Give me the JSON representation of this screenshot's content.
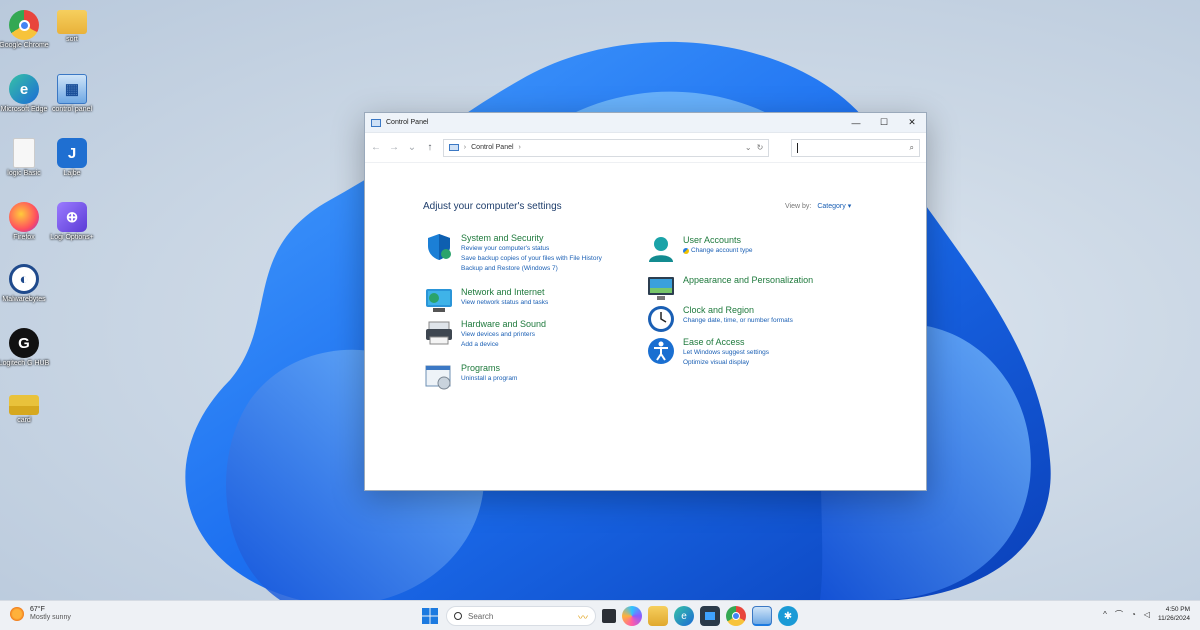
{
  "desktop": {
    "icons": [
      {
        "label": "Google Chrome",
        "color": "#e8453c",
        "glyph": "●"
      },
      {
        "label": "Microsoft Edge",
        "color": "#1c8ad6",
        "glyph": "e"
      },
      {
        "label": "logic Basic",
        "color": "#f2f2f2",
        "glyph": ""
      },
      {
        "label": "Firefox",
        "color": "#ff7139",
        "glyph": "●"
      },
      {
        "label": "Malwarebytes",
        "color": "#1f4a8c",
        "glyph": "◐"
      },
      {
        "label": "Logitech G HUB",
        "color": "#111111",
        "glyph": "G"
      },
      {
        "label": "card",
        "color": "#e9c23b",
        "glyph": "▬"
      },
      {
        "label": "sort",
        "color": "#f1c24c",
        "glyph": "▭"
      },
      {
        "label": "control panel",
        "color": "#4a8fd6",
        "glyph": "▦"
      },
      {
        "label": "Lajbe",
        "color": "#1f6fd1",
        "glyph": "J"
      },
      {
        "label": "Logi Options+",
        "color": "#7b5bd6",
        "glyph": "⊕"
      }
    ]
  },
  "window": {
    "title": "Control Panel",
    "controls": {
      "minimize": "—",
      "maximize": "☐",
      "close": "✕"
    },
    "nav": {
      "back": "←",
      "forward": "→",
      "recent": "⌄",
      "up": "↑"
    },
    "address": {
      "separator": "›",
      "location": "Control Panel",
      "dropdown": "⌄",
      "refresh": "↻"
    },
    "search": {
      "placeholder": "",
      "icon": "⌕"
    },
    "heading": "Adjust your computer's settings",
    "view_by": {
      "label": "View by:",
      "value": "Category ▾"
    },
    "categories_left": [
      {
        "title": "System and Security",
        "links": [
          "Review your computer's status",
          "Save backup copies of your files with File History",
          "Backup and Restore (Windows 7)"
        ],
        "icon": "shield-icon"
      },
      {
        "title": "Network and Internet",
        "links": [
          "View network status and tasks"
        ],
        "icon": "network-icon"
      },
      {
        "title": "Hardware and Sound",
        "links": [
          "View devices and printers",
          "Add a device"
        ],
        "icon": "printer-icon"
      },
      {
        "title": "Programs",
        "links": [
          "Uninstall a program"
        ],
        "icon": "programs-icon"
      }
    ],
    "categories_right": [
      {
        "title": "User Accounts",
        "links": [
          "Change account type"
        ],
        "icon": "user-icon"
      },
      {
        "title": "Appearance and Personalization",
        "links": [],
        "icon": "monitor-icon"
      },
      {
        "title": "Clock and Region",
        "links": [
          "Change date, time, or number formats"
        ],
        "icon": "clock-icon"
      },
      {
        "title": "Ease of Access",
        "links": [
          "Let Windows suggest settings",
          "Optimize visual display"
        ],
        "icon": "accessibility-icon"
      }
    ]
  },
  "taskbar": {
    "weather": {
      "temp": "67°F",
      "condition": "Mostly sunny"
    },
    "search_label": "Search",
    "apps": [
      "start-icon",
      "task-view-icon",
      "copilot-icon",
      "file-explorer-icon",
      "edge-icon",
      "store-icon",
      "chrome-icon",
      "control-panel-icon",
      "app-icon"
    ],
    "tray": {
      "chevron": "^",
      "time": "4:50 PM",
      "date": "11/26/2024"
    }
  },
  "colors": {
    "accent": "#1a5fb4",
    "category_title": "#1f7a3d",
    "heading": "#1e3d6b",
    "taskbar": "#eef1f5"
  }
}
